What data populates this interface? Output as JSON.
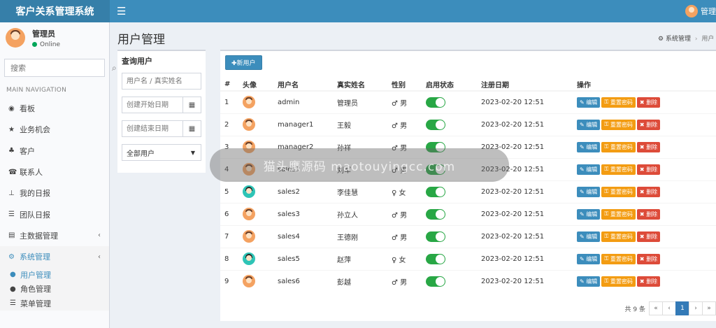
{
  "app": {
    "title": "客户关系管理系统",
    "top_user": "管理"
  },
  "sidebar": {
    "user_name": "管理员",
    "user_status": "Online",
    "search_placeholder": "搜索",
    "nav_header": "MAIN NAVIGATION",
    "items": [
      {
        "label": "看板",
        "icon": "dashboard-icon",
        "glyph": "◉"
      },
      {
        "label": "业务机会",
        "icon": "star-icon",
        "glyph": "★"
      },
      {
        "label": "客户",
        "icon": "sitemap-icon",
        "glyph": "♣"
      },
      {
        "label": "联系人",
        "icon": "phone-icon",
        "glyph": "☎"
      },
      {
        "label": "我的日报",
        "icon": "pin-icon",
        "glyph": "⊥"
      },
      {
        "label": "团队日报",
        "icon": "list-icon",
        "glyph": "☰"
      },
      {
        "label": "主数据管理",
        "icon": "database-icon",
        "glyph": "▤"
      },
      {
        "label": "系统管理",
        "icon": "cogs-icon",
        "glyph": "⚙"
      }
    ],
    "submenu": [
      {
        "label": "用户管理",
        "icon": "user-icon",
        "glyph": "●"
      },
      {
        "label": "角色管理",
        "icon": "users-icon",
        "glyph": "●"
      },
      {
        "label": "菜单管理",
        "icon": "list-icon",
        "glyph": "☰"
      }
    ]
  },
  "page": {
    "title": "用户管理",
    "breadcrumb": [
      "系统管理",
      "用户"
    ]
  },
  "query": {
    "title": "查询用户",
    "name_placeholder": "用户名 / 真实姓名",
    "start_placeholder": "创建开始日期",
    "end_placeholder": "创建结束日期",
    "filter_selected": "全部用户"
  },
  "main": {
    "new_button": "✚新用户",
    "columns": [
      "#",
      "头像",
      "用户名",
      "真实姓名",
      "性别",
      "启用状态",
      "注册日期",
      "操作"
    ],
    "action_labels": {
      "edit": "编辑",
      "reset": "重置密码",
      "delete": "删除"
    },
    "rows": [
      {
        "no": "1",
        "username": "admin",
        "realname": "管理员",
        "gender": "♂ 男",
        "female": false,
        "enabled": true,
        "date": "2023-02-20 12:51"
      },
      {
        "no": "2",
        "username": "manager1",
        "realname": "王毅",
        "gender": "♂ 男",
        "female": false,
        "enabled": true,
        "date": "2023-02-20 12:51"
      },
      {
        "no": "3",
        "username": "manager2",
        "realname": "孙祥",
        "gender": "♂ 男",
        "female": false,
        "enabled": true,
        "date": "2023-02-20 12:51"
      },
      {
        "no": "4",
        "username": "sales1",
        "realname": "刘军",
        "gender": "♂ 男",
        "female": false,
        "enabled": true,
        "date": "2023-02-20 12:51"
      },
      {
        "no": "5",
        "username": "sales2",
        "realname": "李佳慧",
        "gender": "♀ 女",
        "female": true,
        "enabled": true,
        "date": "2023-02-20 12:51"
      },
      {
        "no": "6",
        "username": "sales3",
        "realname": "孙立人",
        "gender": "♂ 男",
        "female": false,
        "enabled": true,
        "date": "2023-02-20 12:51"
      },
      {
        "no": "7",
        "username": "sales4",
        "realname": "王德刚",
        "gender": "♂ 男",
        "female": false,
        "enabled": true,
        "date": "2023-02-20 12:51"
      },
      {
        "no": "8",
        "username": "sales5",
        "realname": "赵萍",
        "gender": "♀ 女",
        "female": true,
        "enabled": true,
        "date": "2023-02-20 12:51"
      },
      {
        "no": "9",
        "username": "sales6",
        "realname": "彭越",
        "gender": "♂ 男",
        "female": false,
        "enabled": true,
        "date": "2023-02-20 12:51"
      }
    ],
    "pager": {
      "total": "共 9 条",
      "first": "«",
      "prev": "‹",
      "current": "1",
      "next": "›",
      "last": "»"
    }
  },
  "watermark": "猫头鹰源码 maotouyingcc.com",
  "colors": {
    "primary": "#3c8dbc",
    "warning": "#f39c12",
    "danger": "#dd4b39",
    "success": "#28a745"
  }
}
